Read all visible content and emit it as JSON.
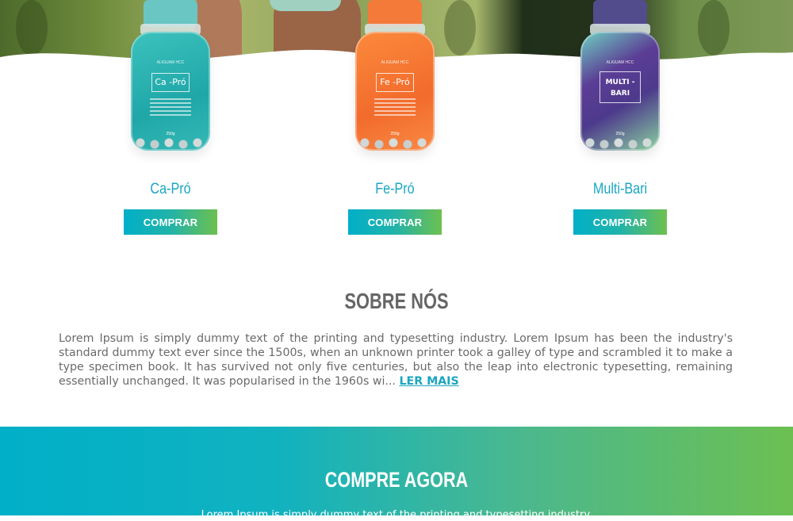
{
  "colors": {
    "accent": "#19a6c1",
    "gradient_start": "#00afc8",
    "gradient_end": "#6dc04f",
    "heading_gray": "#666666"
  },
  "products": [
    {
      "name": "Ca-Pró",
      "jar_label": "Ca -Pró",
      "brand": "ALIGUAM HCC",
      "weight": "250g",
      "button": "COMPRAR",
      "cap_color": "#69c6c2",
      "body_color": "#2bb3b1"
    },
    {
      "name": "Fe-Pró",
      "jar_label": "Fe -Pró",
      "brand": "ALIGUAM HCC",
      "weight": "250g",
      "button": "COMPRAR",
      "cap_color": "#f47a3a",
      "body_color": "#f47f33"
    },
    {
      "name": "Multi-Bari",
      "jar_label": "MULTI -BARI",
      "brand": "ALIGUAM HCC",
      "weight": "250g",
      "button": "COMPRAR",
      "cap_color": "#524c8c",
      "body_color": "#5d3f94"
    }
  ],
  "about": {
    "title": "SOBRE NÓS",
    "text": "Lorem Ipsum is simply dummy text of the printing and typesetting industry. Lorem Ipsum has been the industry's standard dummy text ever since the 1500s, when an unknown printer took a galley of type and scrambled it to make a type specimen book. It has survived not only five centuries, but also the leap into electronic typesetting, remaining essentially unchanged. It was popularised in the 1960s wi...",
    "read_more": "LER MAIS"
  },
  "buy": {
    "title": "COMPRE AGORA",
    "text": "Lorem Ipsum is simply dummy text of the printing and typesetting industry."
  }
}
